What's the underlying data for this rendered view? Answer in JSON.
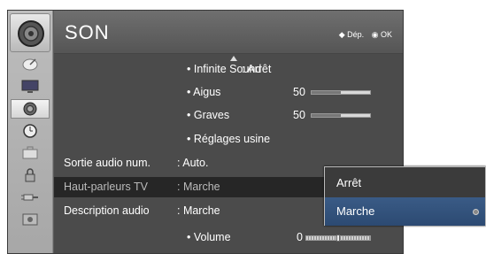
{
  "header": {
    "title": "SON",
    "hint_move": "◆ Dép.",
    "hint_ok": "◉ OK"
  },
  "sidebar": {
    "top_icon": "speaker-icon",
    "items": [
      {
        "icon": "satellite-dish-icon",
        "active": false
      },
      {
        "icon": "monitor-icon",
        "active": false
      },
      {
        "icon": "speaker-icon",
        "active": true
      },
      {
        "icon": "clock-icon",
        "active": false
      },
      {
        "icon": "briefcase-icon",
        "active": false
      },
      {
        "icon": "lock-icon",
        "active": false
      },
      {
        "icon": "cable-plug-icon",
        "active": false
      },
      {
        "icon": "support-icon",
        "active": false
      }
    ]
  },
  "menu": {
    "infinite_sound": {
      "label": "• Infinite Sound",
      "value": ": Arrêt"
    },
    "aigus": {
      "label": "• Aigus",
      "value": "50",
      "level": 0.5
    },
    "graves": {
      "label": "• Graves",
      "value": "50",
      "level": 0.5
    },
    "reglages": {
      "label": "• Réglages usine"
    },
    "sortie": {
      "label": "Sortie audio num.",
      "value": ": Auto."
    },
    "haut_parleurs": {
      "label": "Haut-parleurs TV",
      "value": ": Marche"
    },
    "description": {
      "label": "Description audio",
      "value": ": Marche"
    },
    "volume": {
      "label": "• Volume",
      "value": "0",
      "level": 0.5
    }
  },
  "popup": {
    "options": [
      "Arrêt",
      "Marche"
    ],
    "selected": "Marche"
  }
}
